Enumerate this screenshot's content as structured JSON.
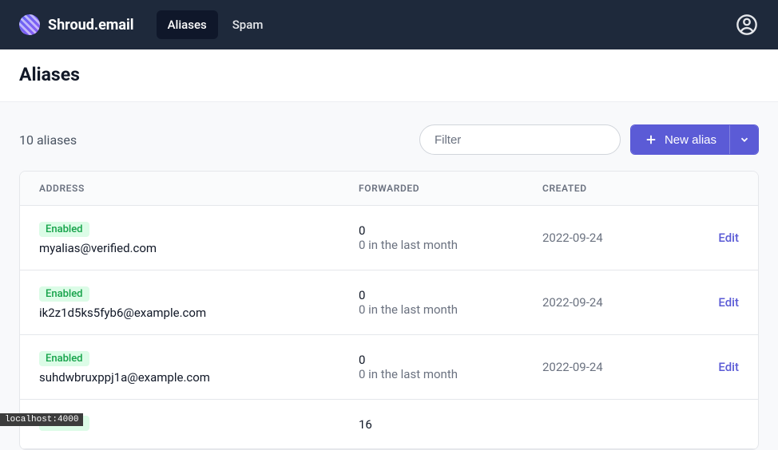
{
  "brand": "Shroud.email",
  "nav": {
    "tabs": [
      {
        "label": "Aliases",
        "active": true
      },
      {
        "label": "Spam",
        "active": false
      }
    ]
  },
  "page_title": "Aliases",
  "toolbar": {
    "count_label": "10 aliases",
    "filter_placeholder": "Filter",
    "new_alias_label": "New alias"
  },
  "table": {
    "headers": {
      "address": "ADDRESS",
      "forwarded": "FORWARDED",
      "created": "CREATED"
    },
    "forwarded_month_suffix": " in the last month",
    "edit_label": "Edit",
    "rows": [
      {
        "status": "Enabled",
        "address": "myalias@verified.com",
        "forwarded_total": "0",
        "forwarded_month": "0",
        "created": "2022-09-24"
      },
      {
        "status": "Enabled",
        "address": "ik2z1d5ks5fyb6@example.com",
        "forwarded_total": "0",
        "forwarded_month": "0",
        "created": "2022-09-24"
      },
      {
        "status": "Enabled",
        "address": "suhdwbruxppj1a@example.com",
        "forwarded_total": "0",
        "forwarded_month": "0",
        "created": "2022-09-24"
      },
      {
        "status": "Enabled",
        "address": "",
        "forwarded_total": "16",
        "forwarded_month": "",
        "created": ""
      }
    ]
  },
  "status_bar": "localhost:4000"
}
